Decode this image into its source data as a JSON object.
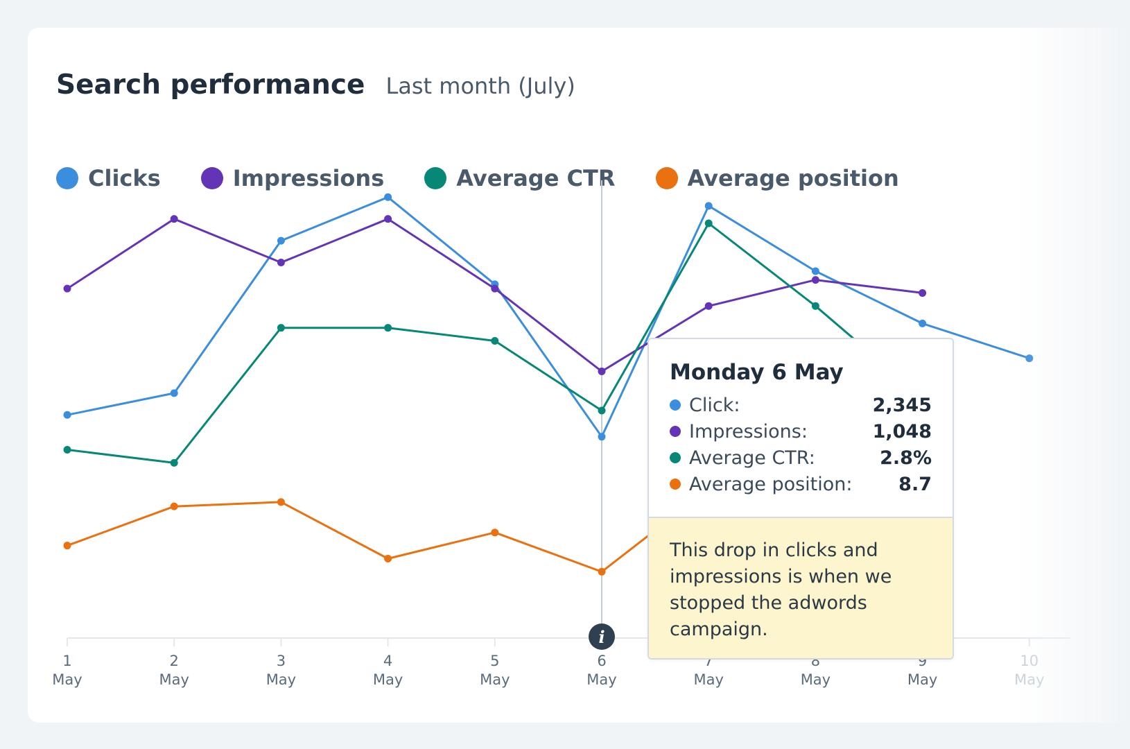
{
  "card": {
    "title": "Search performance",
    "subtitle": "Last month (July)"
  },
  "legend": [
    {
      "label": "Clicks",
      "color": "#3b8ddd"
    },
    {
      "label": "Impressions",
      "color": "#6334b6"
    },
    {
      "label": "Average CTR",
      "color": "#078776"
    },
    {
      "label": "Average position",
      "color": "#ea7110"
    }
  ],
  "tooltip": {
    "title": "Monday 6 May",
    "rows": [
      {
        "label": "Click:",
        "value": "2,345",
        "color": "#3b8ddd"
      },
      {
        "label": "Impressions:",
        "value": "1,048",
        "color": "#6334b6"
      },
      {
        "label": "Average CTR:",
        "value": "2.8%",
        "color": "#078776"
      },
      {
        "label": "Average position:",
        "value": "8.7",
        "color": "#ea7110"
      }
    ],
    "note": "This drop in clicks and impressions is when we stopped the adwords campaign."
  },
  "chart_data": {
    "type": "line",
    "x": [
      "1",
      "2",
      "3",
      "4",
      "5",
      "6",
      "7",
      "8",
      "9",
      "10"
    ],
    "x_month": "May",
    "ylim": [
      0,
      100
    ],
    "highlight_index": 5,
    "grid": false,
    "legend_position": "top-left",
    "series": [
      {
        "name": "Clicks",
        "color": "#3b8ddd",
        "values": [
          49,
          54,
          89,
          99,
          79,
          44,
          97,
          82,
          70,
          62
        ]
      },
      {
        "name": "Impressions",
        "color": "#6334b6",
        "values": [
          78,
          94,
          84,
          94,
          78,
          59,
          74,
          80,
          77,
          null
        ]
      },
      {
        "name": "Average CTR",
        "color": "#078776",
        "values": [
          41,
          38,
          69,
          69,
          66,
          50,
          93,
          74,
          53,
          null
        ]
      },
      {
        "name": "Average position",
        "color": "#ea7110",
        "values": [
          19,
          28,
          29,
          16,
          22,
          13,
          32,
          27,
          20,
          null
        ]
      }
    ]
  }
}
